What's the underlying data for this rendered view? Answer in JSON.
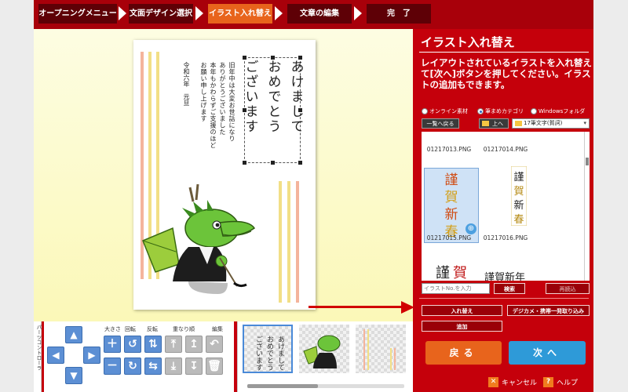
{
  "steps": [
    {
      "label": "オープニングメニュー"
    },
    {
      "label": "文面デザイン選択"
    },
    {
      "label": "イラスト入れ替え"
    },
    {
      "label": "文章の編集"
    },
    {
      "label": "完　了"
    }
  ],
  "card": {
    "headline_lines": [
      "あけまして",
      "おめでとう",
      "ございます"
    ],
    "greeting_lines": [
      "旧年中は大変お世話になり",
      "ありがとうございました",
      "本年もかわらずご支援のほど",
      "お願い申し上げます"
    ],
    "date_line": "令和六年　元旦"
  },
  "panel": {
    "title": "イラスト入れ替え",
    "description": "レイアウトされているイラストを入れ替えて[次へ]ボタンを押してください。イラストの追加もできます。",
    "radios": [
      {
        "label": "オンライン素材",
        "selected": false
      },
      {
        "label": "筆まめカテゴリ",
        "selected": true
      },
      {
        "label": "Windowsフォルダ",
        "selected": false
      }
    ],
    "back_to_list": "一覧へ戻る",
    "up": "上へ",
    "folder_select": "17筆文字(賀詞)",
    "files": [
      "01217013.PNG",
      "01217014.PNG",
      "01217015.PNG",
      "01217016.PNG"
    ],
    "search_placeholder": "イラストNo.を入力",
    "search_button": "検索",
    "reload_button": "再読込",
    "replace_button": "入れ替え",
    "camera_button": "デジカメ・携帯一発取り込み",
    "add_button": "追加",
    "back_button": "戻る",
    "next_button": "次へ",
    "cancel_label": "キャンセル",
    "help_label": "ヘルプ"
  },
  "toolbox": {
    "side_label": "パーツコントローラ",
    "headers": [
      "大きさ",
      "回転",
      "反転",
      "重なり順",
      "編集"
    ]
  },
  "colors": {
    "brand_red": "#c5000b",
    "active_step": "#e8641c",
    "back_button": "#e8641c",
    "next_button": "#2e9ad8"
  }
}
